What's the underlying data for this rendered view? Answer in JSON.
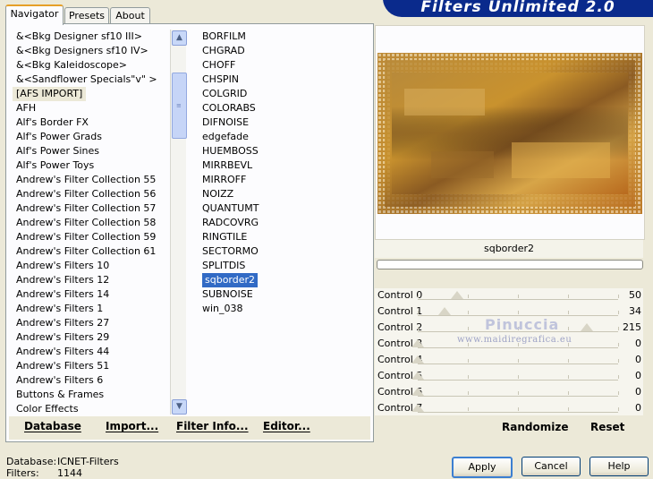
{
  "app": {
    "title": "Filters Unlimited 2.0"
  },
  "tabs": [
    "Navigator",
    "Presets",
    "About"
  ],
  "categories": [
    "&<Bkg Designer sf10 III>",
    "&<Bkg Designers sf10 IV>",
    "&<Bkg Kaleidoscope>",
    "&<Sandflower Specials\"v\" >",
    "[AFS IMPORT]",
    "AFH",
    "Alf's Border FX",
    "Alf's Power Grads",
    "Alf's Power Sines",
    "Alf's Power Toys",
    "Andrew's Filter Collection 55",
    "Andrew's Filter Collection 56",
    "Andrew's Filter Collection 57",
    "Andrew's Filter Collection 58",
    "Andrew's Filter Collection 59",
    "Andrew's Filter Collection 61",
    "Andrew's Filters 10",
    "Andrew's Filters 12",
    "Andrew's Filters 14",
    "Andrew's Filters 1",
    "Andrew's Filters 27",
    "Andrew's Filters 29",
    "Andrew's Filters 44",
    "Andrew's Filters 51",
    "Andrew's Filters 6",
    "Buttons & Frames",
    "Color Effects"
  ],
  "selected_category": "[AFS IMPORT]",
  "filters": [
    "BORFILM",
    "CHGRAD",
    "CHOFF",
    "CHSPIN",
    "COLGRID",
    "COLORABS",
    "DIFNOISE",
    "edgefade",
    "HUEMBOSS",
    "MIRRBEVL",
    "MIRROFF",
    "NOIZZ",
    "QUANTUMT",
    "RADCOVRG",
    "RINGTILE",
    "SECTORMO",
    "SPLITDIS",
    "sqborder2",
    "SUBNOISE",
    "win_038"
  ],
  "selected_filter": "sqborder2",
  "left_buttons": {
    "database": "Database",
    "import": "Import...",
    "filter_info": "Filter Info...",
    "editor": "Editor..."
  },
  "preview": {
    "filter_name": "sqborder2"
  },
  "controls": [
    {
      "label": "Control 0",
      "value": 50
    },
    {
      "label": "Control 1",
      "value": 34
    },
    {
      "label": "Control 2",
      "value": 215
    },
    {
      "label": "Control 3",
      "value": 0
    },
    {
      "label": "Control 4",
      "value": 0
    },
    {
      "label": "Control 5",
      "value": 0
    },
    {
      "label": "Control 6",
      "value": 0
    },
    {
      "label": "Control 7",
      "value": 0
    }
  ],
  "watermark": {
    "name": "Pinuccia",
    "url": "www.maidiregrafica.eu"
  },
  "right_buttons": {
    "randomize": "Randomize",
    "reset": "Reset"
  },
  "status": {
    "database_label": "Database:",
    "database_value": "ICNET-Filters",
    "filters_label": "Filters:",
    "filters_value": "1144"
  },
  "dialog_buttons": {
    "apply": "Apply",
    "cancel": "Cancel",
    "help": "Help"
  },
  "colors": {
    "banner": "#0a2a8c",
    "selection": "#316ac5",
    "tab_accent": "#e6a028"
  }
}
